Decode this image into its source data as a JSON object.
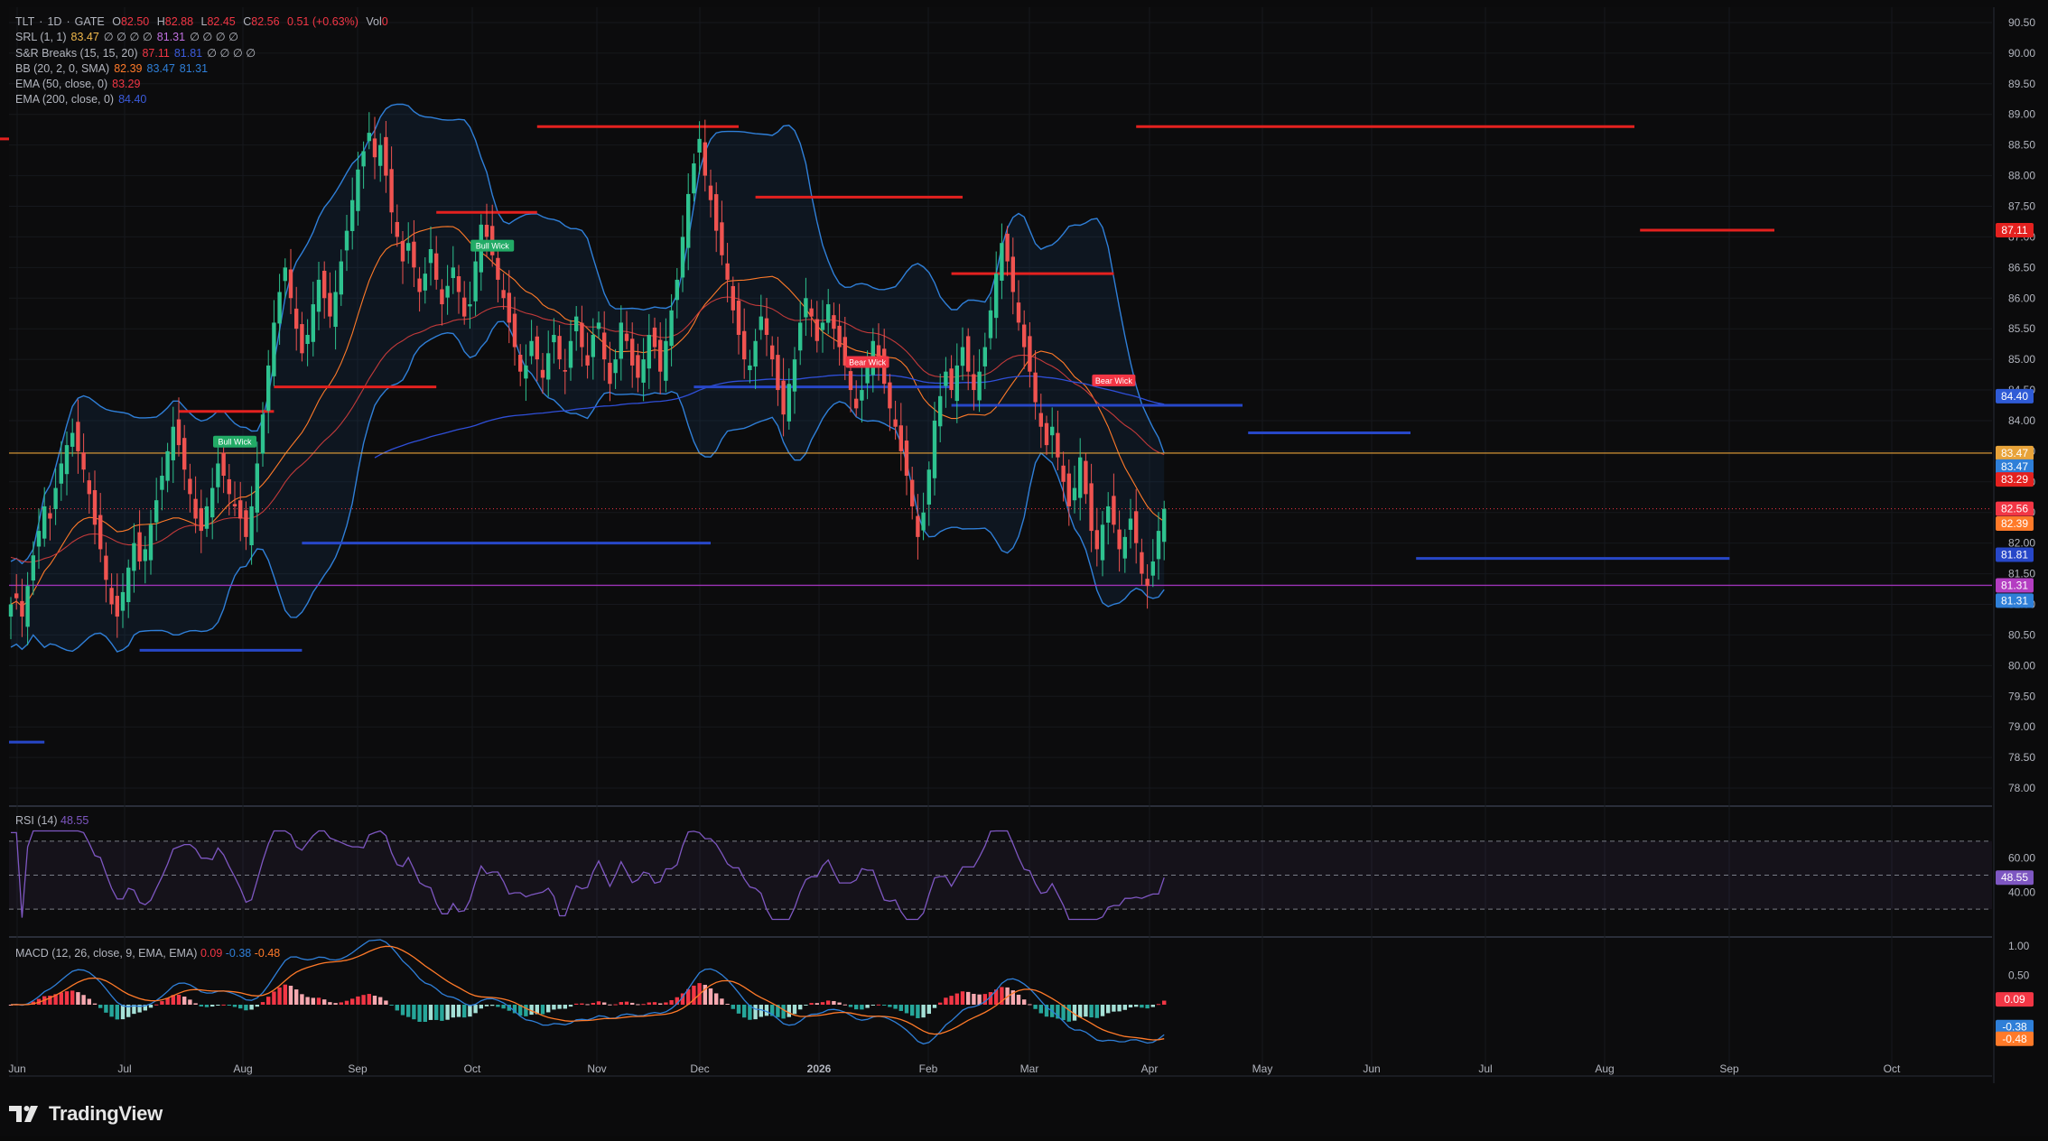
{
  "header": {
    "symbol": "TLT",
    "interval": "1D",
    "exchange": "GATE",
    "open_label": "O",
    "open": "82.50",
    "high_label": "H",
    "high": "82.88",
    "low_label": "L",
    "low": "82.45",
    "close_label": "C",
    "close": "82.56",
    "change": "0.51 (+0.63%)",
    "volume_label": "Vol",
    "volume": "0"
  },
  "indicators": [
    {
      "name": "SRL (1, 1)",
      "values": [
        {
          "v": "83.47",
          "c": "#f0b84b"
        },
        {
          "v": "∅ ∅ ∅ ∅",
          "c": "#b2b5be"
        },
        {
          "v": "81.31",
          "c": "#c070e0"
        },
        {
          "v": "∅ ∅ ∅ ∅",
          "c": "#b2b5be"
        }
      ]
    },
    {
      "name": "S&R Breaks (15, 15, 20)",
      "values": [
        {
          "v": "87.11",
          "c": "#f23645"
        },
        {
          "v": "81.81",
          "c": "#3b5bdb"
        },
        {
          "v": "∅ ∅ ∅ ∅",
          "c": "#b2b5be"
        }
      ]
    },
    {
      "name": "BB (20, 2, 0, SMA)",
      "values": [
        {
          "v": "82.39",
          "c": "#ff7a29"
        },
        {
          "v": "83.47",
          "c": "#2f7fd8"
        },
        {
          "v": "81.31",
          "c": "#2f7fd8"
        }
      ]
    },
    {
      "name": "EMA (50, close, 0)",
      "values": [
        {
          "v": "83.29",
          "c": "#f23645"
        }
      ]
    },
    {
      "name": "EMA (200, close, 0)",
      "values": [
        {
          "v": "84.40",
          "c": "#3b5bdb"
        }
      ]
    }
  ],
  "rsi_label": {
    "name": "RSI (14)",
    "value": "48.55"
  },
  "macd_label": {
    "name": "MACD (12, 26, close, 9, EMA, EMA)",
    "macd": "0.09",
    "signal": "-0.38",
    "hist": "-0.48"
  },
  "price_axis": [
    "90.50",
    "90.00",
    "89.50",
    "89.00",
    "88.50",
    "88.00",
    "87.50",
    "87.00",
    "86.50",
    "86.00",
    "85.50",
    "85.00",
    "84.50",
    "84.00",
    "83.50",
    "83.00",
    "82.50",
    "82.00",
    "81.50",
    "81.00",
    "80.50",
    "80.00",
    "79.50",
    "79.00",
    "78.50",
    "78.00"
  ],
  "rsi_axis": [
    "60.00",
    "40.00"
  ],
  "macd_axis": [
    "1.00",
    "0.50"
  ],
  "time_axis": [
    "Jun",
    "Jul",
    "Aug",
    "Sep",
    "Oct",
    "Nov",
    "Dec",
    "2026",
    "Feb",
    "Mar",
    "Apr",
    "May",
    "Jun",
    "Jul",
    "Aug",
    "Sep",
    "Oct"
  ],
  "price_tags": [
    {
      "value": "87.11",
      "price": 87.11,
      "color": "#e4211f"
    },
    {
      "value": "84.40",
      "price": 84.4,
      "color": "#2f5bd6"
    },
    {
      "value": "83.47",
      "price": 83.47,
      "color": "#e8a33a"
    },
    {
      "value": "83.47",
      "price": 83.25,
      "color": "#2f7fd8"
    },
    {
      "value": "83.29",
      "price": 83.04,
      "color": "#e4211f"
    },
    {
      "value": "82.56",
      "price": 82.56,
      "color": "#f23645"
    },
    {
      "value": "82.39",
      "price": 82.32,
      "color": "#ff7a29"
    },
    {
      "value": "81.81",
      "price": 81.81,
      "color": "#2747c8"
    },
    {
      "value": "81.31",
      "price": 81.31,
      "color": "#b43ec2"
    },
    {
      "value": "81.31",
      "price": 81.06,
      "color": "#2f7fd8"
    }
  ],
  "rsi_tag": {
    "value": "48.55",
    "color": "#7e57c2"
  },
  "macd_tags": [
    {
      "value": "0.09",
      "color": "#f23645"
    },
    {
      "value": "-0.38",
      "color": "#2f7fd8"
    },
    {
      "value": "-0.48",
      "color": "#ff7a29"
    }
  ],
  "signals": [
    {
      "text": "Bull Wick",
      "color": "#22ab66",
      "x_index": 40,
      "price": 83.65
    },
    {
      "text": "Bull Wick",
      "color": "#22ab66",
      "x_index": 86,
      "price": 86.85
    },
    {
      "text": "Bear Wick",
      "color": "#f23645",
      "x_index": 153,
      "price": 84.95
    },
    {
      "text": "Bear Wick",
      "color": "#f23645",
      "x_index": 197,
      "price": 84.65
    }
  ],
  "footer": {
    "brand": "TradingView"
  },
  "colors": {
    "bull": "#26a69a",
    "bull_bright": "#2ec28f",
    "bear": "#ef5350",
    "bb": "#2f7fd8",
    "ema50": "#e4402f",
    "ema200": "#2f4fd8",
    "rsi": "#7e57c2",
    "resistance": "#e4211f",
    "support": "#2747c8",
    "srl_yellow": "#e8a33a",
    "srl_purple": "#9c33b5"
  },
  "chart_data": {
    "type": "candlestick",
    "symbol": "TLT",
    "interval": "1D",
    "x_range": [
      "2025-06-01",
      "2026-10-31"
    ],
    "ylim": [
      77.75,
      90.75
    ],
    "close_series": [
      81.0,
      81.1,
      80.8,
      81.3,
      81.8,
      82.2,
      82.6,
      82.4,
      82.9,
      83.3,
      83.6,
      83.8,
      83.5,
      83.2,
      82.8,
      82.3,
      81.9,
      81.4,
      81.0,
      80.8,
      81.2,
      81.6,
      82.0,
      81.7,
      81.9,
      82.3,
      82.7,
      83.1,
      83.5,
      83.9,
      83.6,
      83.2,
      82.8,
      82.4,
      82.2,
      82.6,
      82.9,
      83.3,
      83.1,
      82.8,
      82.6,
      82.4,
      82.1,
      82.6,
      83.3,
      84.1,
      84.9,
      85.6,
      86.1,
      86.5,
      86.0,
      85.5,
      85.1,
      85.4,
      85.9,
      86.3,
      86.0,
      85.7,
      86.1,
      86.6,
      87.1,
      87.6,
      88.1,
      88.4,
      88.7,
      88.3,
      88.5,
      88.0,
      87.4,
      87.0,
      86.6,
      86.9,
      86.5,
      86.1,
      86.4,
      86.8,
      86.3,
      85.9,
      86.2,
      86.5,
      86.1,
      85.7,
      85.9,
      86.6,
      87.2,
      87.0,
      86.7,
      86.3,
      86.0,
      85.6,
      85.2,
      84.8,
      84.9,
      85.3,
      85.0,
      84.7,
      85.1,
      85.4,
      85.0,
      84.8,
      85.3,
      85.7,
      85.2,
      84.9,
      85.4,
      85.6,
      85.0,
      84.6,
      85.0,
      85.6,
      85.3,
      84.9,
      84.7,
      85.0,
      85.4,
      85.2,
      84.8,
      85.3,
      85.8,
      86.3,
      87.0,
      87.7,
      88.2,
      88.6,
      88.0,
      87.6,
      87.1,
      86.7,
      86.3,
      85.8,
      85.4,
      85.0,
      84.9,
      85.3,
      85.7,
      85.4,
      85.0,
      84.5,
      84.1,
      84.6,
      85.0,
      85.6,
      86.0,
      85.7,
      85.3,
      85.6,
      85.9,
      85.5,
      85.2,
      84.9,
      84.5,
      84.2,
      84.5,
      84.9,
      85.3,
      85.0,
      84.6,
      84.2,
      83.9,
      83.5,
      83.1,
      82.6,
      82.1,
      82.5,
      83.2,
      84.0,
      84.4,
      84.8,
      84.5,
      84.9,
      85.2,
      84.8,
      84.5,
      84.8,
      85.2,
      85.8,
      86.4,
      86.9,
      86.6,
      86.1,
      85.6,
      85.2,
      84.8,
      84.3,
      83.9,
      83.6,
      83.9,
      83.4,
      83.0,
      82.6,
      82.9,
      83.4,
      82.8,
      82.2,
      81.9,
      82.3,
      82.6,
      82.3,
      81.9,
      82.1,
      82.4,
      82.0,
      81.5,
      81.3,
      81.7,
      82.2,
      82.56
    ],
    "series": [
      {
        "name": "BB (20, 2, 0, SMA)",
        "values": [
          82.39,
          83.47,
          81.31
        ]
      },
      {
        "name": "EMA (50, close, 0)",
        "values": [
          83.29
        ]
      },
      {
        "name": "EMA (200, close, 0)",
        "values": [
          84.4
        ]
      },
      {
        "name": "RSI (14)",
        "values": [
          48.55
        ]
      },
      {
        "name": "MACD (12, 26, close, 9, EMA, EMA)",
        "values": [
          0.09,
          -0.38,
          -0.48
        ]
      }
    ],
    "resistance_levels": [
      {
        "price": 88.6,
        "from": -20,
        "to": -6
      },
      {
        "price": 84.15,
        "from": 30,
        "to": 47
      },
      {
        "price": 84.55,
        "from": 47,
        "to": 76
      },
      {
        "price": 87.4,
        "from": 76,
        "to": 94
      },
      {
        "price": 88.8,
        "from": 94,
        "to": 130
      },
      {
        "price": 87.65,
        "from": 133,
        "to": 170
      },
      {
        "price": 86.4,
        "from": 168,
        "to": 197
      },
      {
        "price": 88.8,
        "from": 201,
        "to": 290
      },
      {
        "price": 87.11,
        "from": 291,
        "to": 315
      }
    ],
    "support_levels": [
      {
        "price": 78.75,
        "from": -20,
        "to": 6
      },
      {
        "price": 80.25,
        "from": 23,
        "to": 52
      },
      {
        "price": 82.0,
        "from": 52,
        "to": 125
      },
      {
        "price": 84.55,
        "from": 122,
        "to": 168
      },
      {
        "price": 84.25,
        "from": 168,
        "to": 220
      },
      {
        "price": 83.8,
        "from": 221,
        "to": 250
      },
      {
        "price": 81.75,
        "from": 251,
        "to": 307
      }
    ],
    "srl_levels": [
      83.47,
      81.31
    ],
    "last_price": 82.56,
    "rsi_levels": [
      70,
      50,
      30
    ],
    "macd_hist_last": 0.09,
    "xlabel": "",
    "ylabel": ""
  }
}
